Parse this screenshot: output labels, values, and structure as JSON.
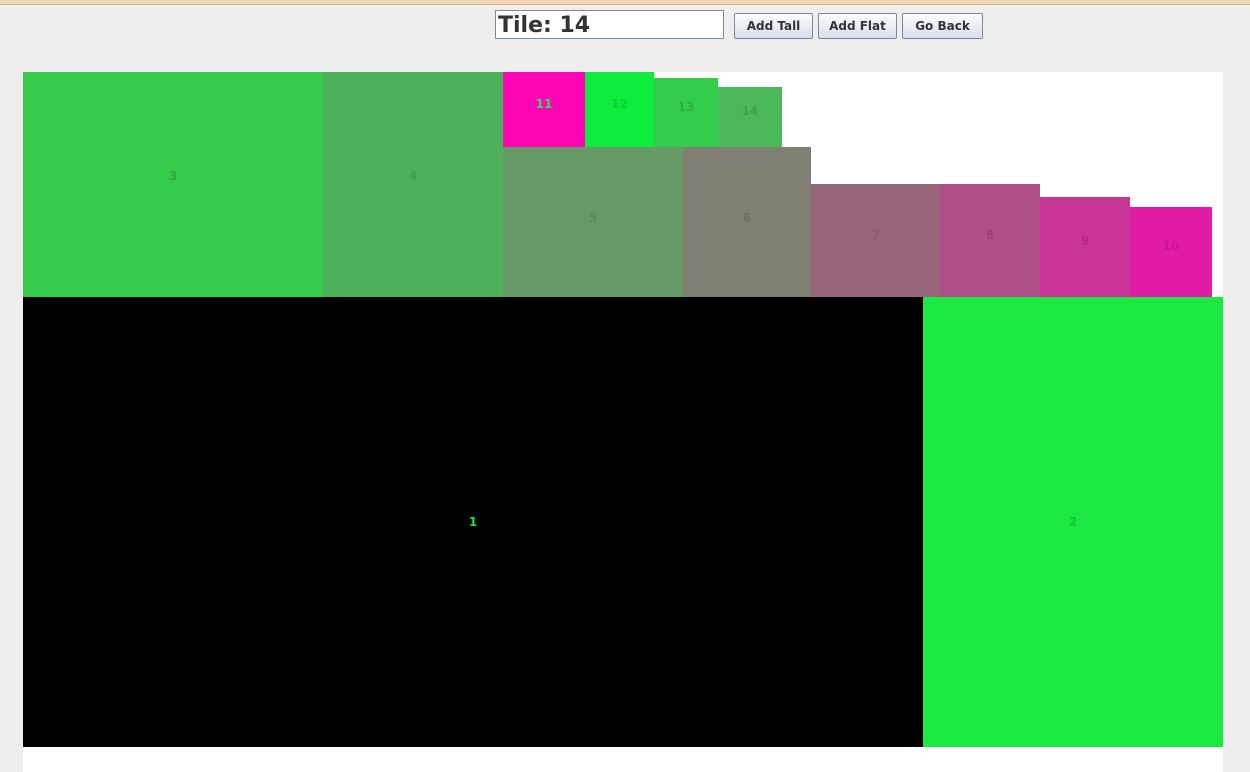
{
  "toolbar": {
    "tile_field_value": "Tile: 14",
    "add_tall_label": "Add Tall",
    "add_flat_label": "Add Flat",
    "go_back_label": "Go Back"
  },
  "tiles": [
    {
      "label": "1",
      "fill": "#000000",
      "text_color": "#1ce840"
    },
    {
      "label": "2",
      "fill": "#1be840",
      "text_color": "#14c236"
    },
    {
      "label": "3",
      "fill": "#35cb4a",
      "text_color": "#2aa83c"
    },
    {
      "label": "4",
      "fill": "#4db15a",
      "text_color": "#3f9a4c"
    },
    {
      "label": "5",
      "fill": "#679966",
      "text_color": "#5b8a58"
    },
    {
      "label": "6",
      "fill": "#7f7f74",
      "text_color": "#6e6e66"
    },
    {
      "label": "7",
      "fill": "#98677c",
      "text_color": "#8a5a6e"
    },
    {
      "label": "8",
      "fill": "#af4f8a",
      "text_color": "#9c4279"
    },
    {
      "label": "9",
      "fill": "#c93596",
      "text_color": "#b12a84"
    },
    {
      "label": "10",
      "fill": "#e01ba6",
      "text_color": "#c81592"
    },
    {
      "label": "11",
      "fill": "#ff05b3",
      "text_color": "#2ae05a"
    },
    {
      "label": "12",
      "fill": "#0ded3d",
      "text_color": "#0bcd35"
    },
    {
      "label": "13",
      "fill": "#33cc4a",
      "text_color": "#2bb040"
    },
    {
      "label": "14",
      "fill": "#4bb85a",
      "text_color": "#40a04e"
    }
  ]
}
